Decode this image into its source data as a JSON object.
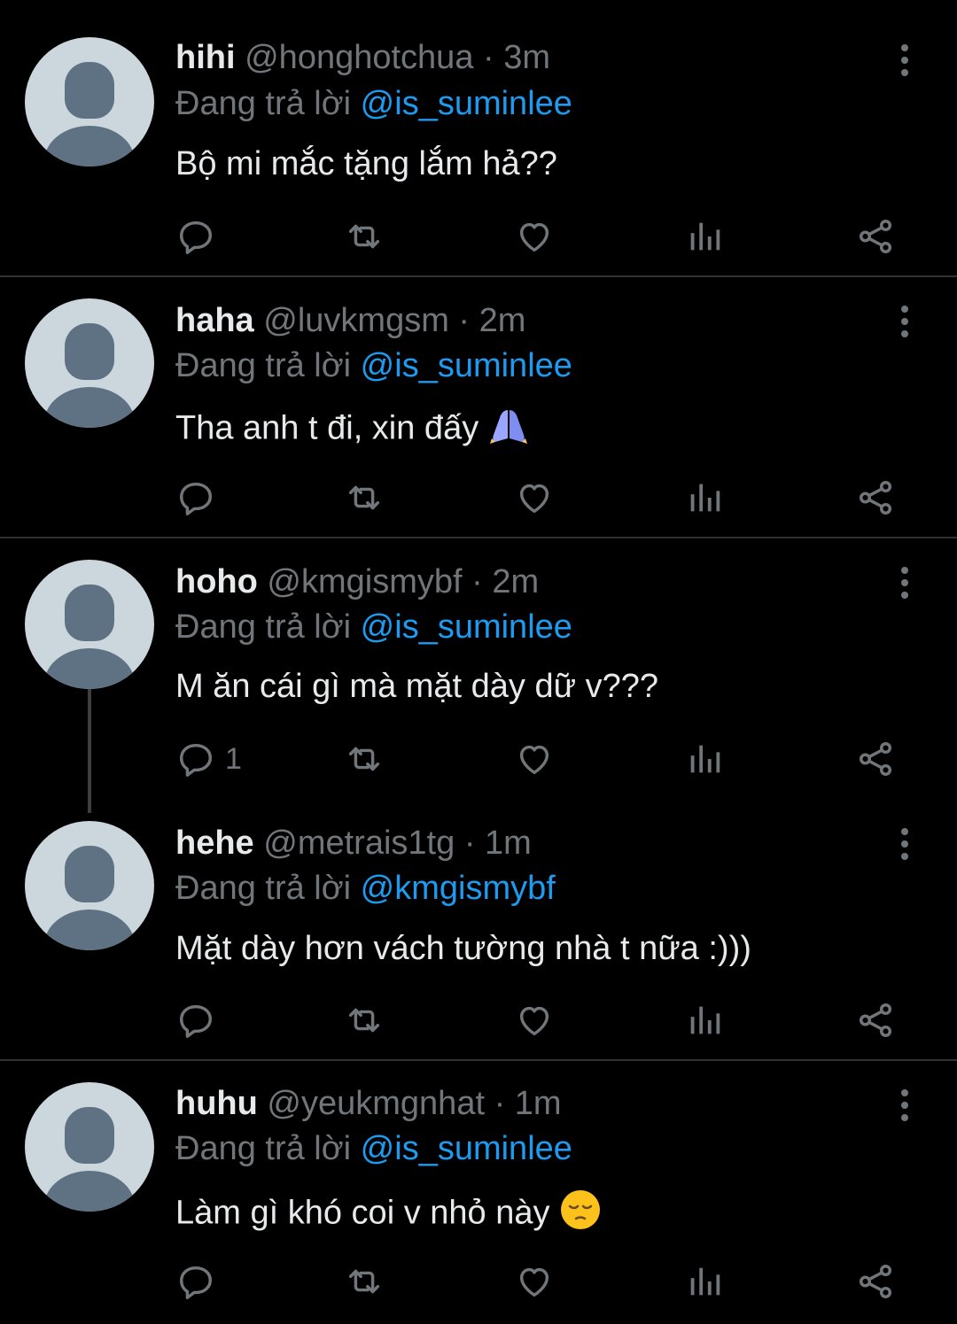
{
  "colors": {
    "background": "#000000",
    "mention": "#1d9bf0",
    "muted": "#71767b",
    "text": "#e7e9ea",
    "avatar_bg": "#ccd6dd",
    "avatar_fg": "#5e7283"
  },
  "tweets": [
    {
      "name": "hihi",
      "handle": "@honghotchua",
      "sep": "·",
      "time": "3m",
      "reply_prefix": "Đang trả lời",
      "reply_to": "@is_suminlee",
      "text": "Bộ mi mắc tặng lắm hả??",
      "emoji": "",
      "reply_count": ""
    },
    {
      "name": "haha",
      "handle": "@luvkmgsm",
      "sep": "·",
      "time": "2m",
      "reply_prefix": "Đang trả lời",
      "reply_to": "@is_suminlee",
      "text": "Tha anh t đi, xin đấy",
      "emoji": "folded-hands-emoji",
      "reply_count": ""
    },
    {
      "name": "hoho",
      "handle": "@kmgismybf",
      "sep": "·",
      "time": "2m",
      "reply_prefix": "Đang trả lời",
      "reply_to": "@is_suminlee",
      "text": "M ăn cái gì mà mặt dày dữ v???",
      "emoji": "",
      "reply_count": "1"
    },
    {
      "name": "hehe",
      "handle": "@metrais1tg",
      "sep": "·",
      "time": "1m",
      "reply_prefix": "Đang trả lời",
      "reply_to": "@kmgismybf",
      "text": "Mặt dày hơn vách tường nhà t nữa :)))",
      "emoji": "",
      "reply_count": ""
    },
    {
      "name": "huhu",
      "handle": "@yeukmgnhat",
      "sep": "·",
      "time": "1m",
      "reply_prefix": "Đang trả lời",
      "reply_to": "@is_suminlee",
      "text": "Làm gì khó coi v nhỏ này",
      "emoji": "pensive-face-emoji",
      "reply_count": ""
    }
  ],
  "icons": [
    "avatar-placeholder",
    "more-vertical-icon",
    "reply-icon",
    "retweet-icon",
    "like-icon",
    "views-icon",
    "share-icon"
  ]
}
